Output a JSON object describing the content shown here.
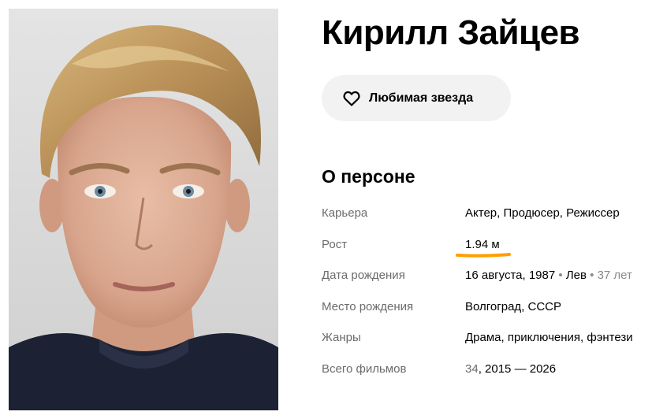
{
  "person": {
    "name": "Кирилл Зайцев"
  },
  "favorite_button": {
    "label": "Любимая звезда",
    "icon": "heart-icon"
  },
  "about": {
    "title": "О персоне",
    "rows": {
      "career": {
        "key": "Карьера",
        "value": "Актер, Продюсер, Режиссер"
      },
      "height": {
        "key": "Рост",
        "value": "1.94 м"
      },
      "birth_date": {
        "key": "Дата рождения",
        "date": "16 августа, 1987",
        "sep1": " • ",
        "zodiac": "Лев",
        "sep2": " • ",
        "age": "37 лет"
      },
      "birth_place": {
        "key": "Место рождения",
        "value": "Волгоград, СССР"
      },
      "genres": {
        "key": "Жанры",
        "value": "Драма, приключения, фэнтези"
      },
      "films": {
        "key": "Всего фильмов",
        "count": "34",
        "sep": ", ",
        "years": "2015 — 2026"
      }
    }
  },
  "colors": {
    "highlight_underline": "#ff9e00",
    "button_bg": "#f2f2f2",
    "muted_text": "#6b6b6b"
  }
}
